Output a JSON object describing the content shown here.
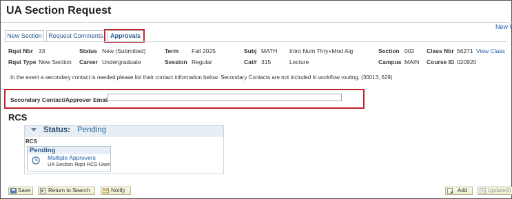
{
  "page": {
    "title": "UA Section Request",
    "new_window": "New W"
  },
  "tabs": [
    {
      "label": "New Section"
    },
    {
      "label": "Request Comments"
    },
    {
      "label": "Approvals"
    }
  ],
  "header_fields": {
    "rqst_nbr_label": "Rqst Nbr",
    "rqst_nbr": "33",
    "status_label": "Status",
    "status": "New (Submitted)",
    "term_label": "Term",
    "term": "Fall 2025",
    "subj_label": "Subj",
    "subj": "MATH",
    "subj_desc": "Intro Num Thry+Mod Alg",
    "section_label": "Section",
    "section": "002",
    "class_nbr_label": "Class Nbr",
    "class_nbr": "56271",
    "view_class": "View Class",
    "rqst_type_label": "Rqst Type",
    "rqst_type": "New Section",
    "career_label": "Career",
    "career": "Undergraduate",
    "session_label": "Session",
    "session": "Regular",
    "cat_label": "Cat#",
    "cat": "315",
    "cat_desc": "Lecture",
    "campus_label": "Campus",
    "campus": "MAIN",
    "course_id_label": "Course ID",
    "course_id": "020920"
  },
  "notice": "In the event a secondary contact is needed please list their contact information below. Secondary Contacts are not included in workflow routing. (30013, 629)",
  "secondary_contact": {
    "label": "Secondary Contact/Approver Email",
    "value": ""
  },
  "rcs": {
    "heading": "RCS",
    "status_label": "Status:",
    "status_value": "Pending",
    "path_label": "RCS",
    "stage_title": "Pending",
    "approver_link": "Multiple Approvers",
    "approver_role": "UA Section Rqst RCS User"
  },
  "toolbar": {
    "save": "Save",
    "return_to_search": "Return to Search",
    "notify": "Notify",
    "add": "Add",
    "update": "Update/D"
  },
  "colors": {
    "highlight": "#c0272d",
    "link": "#1a5ea8",
    "accent_panel": "#e7eef5"
  },
  "icons": {
    "pending": "clock-icon",
    "collapse": "triangle-down-icon"
  }
}
